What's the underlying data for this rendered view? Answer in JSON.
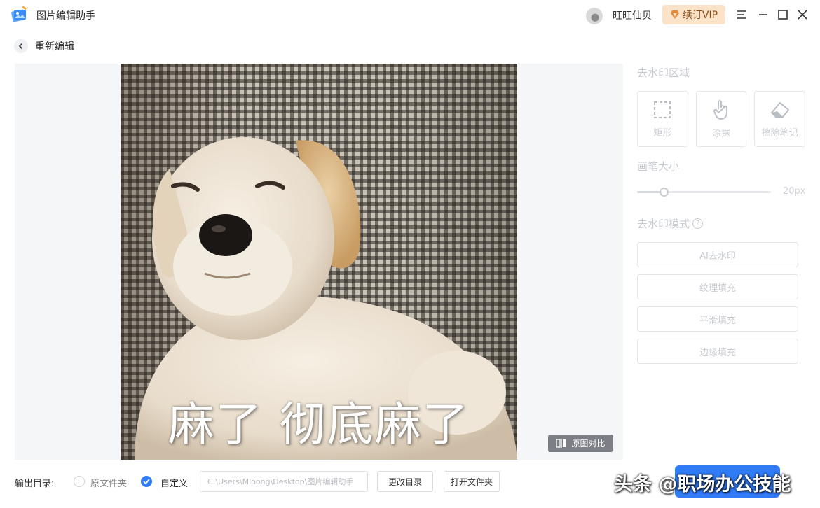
{
  "app": {
    "title": "图片编辑助手",
    "user": "旺旺仙贝",
    "vip_label": "续订VIP"
  },
  "nav": {
    "back_label": "重新编辑"
  },
  "image": {
    "caption": "麻了 彻底麻了",
    "compare_label": "原图对比"
  },
  "panel": {
    "region_title": "去水印区域",
    "tools": [
      {
        "label": "矩形",
        "icon": "rectangle-select-icon"
      },
      {
        "label": "涂抹",
        "icon": "hand-pointer-icon"
      },
      {
        "label": "擦除笔记",
        "icon": "eraser-icon"
      }
    ],
    "brush_title": "画笔大小",
    "brush_value": "20px",
    "brush_level": 0.2,
    "mode_title": "去水印模式",
    "modes": [
      "AI去水印",
      "纹理填充",
      "平滑填充",
      "边缘填充"
    ]
  },
  "bottom": {
    "output_label": "输出目录:",
    "option_original": "原文件夹",
    "option_custom": "自定义",
    "selected": "custom",
    "path": "C:\\Users\\Mloong\\Desktop\\图片编辑助手",
    "change_dir": "更改目录",
    "open_folder": "打开文件夹"
  },
  "watermark": "头条 @职场办公技能",
  "colors": {
    "accent": "#2f7cf6",
    "vip_bg": "#fbe3c9",
    "vip_text": "#8a4a14"
  }
}
